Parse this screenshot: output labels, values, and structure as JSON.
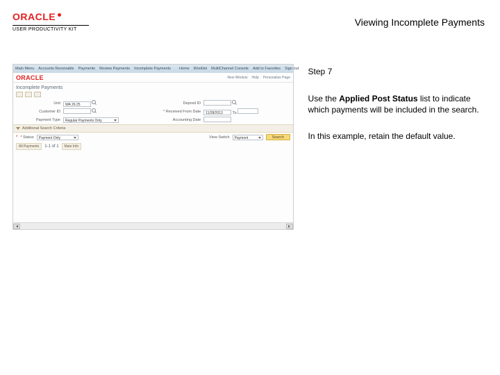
{
  "header": {
    "brand": "ORACLE",
    "upk": "USER PRODUCTIVITY KIT",
    "title": "Viewing Incomplete Payments"
  },
  "instruction": {
    "step": "Step 7",
    "before_bold": "Use the ",
    "bold": "Applied Post Status",
    "after_bold": " list to indicate which payments will be included in the search.",
    "example": "In this example, retain the default value."
  },
  "app": {
    "brand": "ORACLE",
    "breadcrumb": {
      "a": "Main Menu",
      "b": "Accounts Receivable",
      "c": "Payments",
      "d": "Review Payments",
      "e": "Incomplete Payments"
    },
    "topnav": {
      "home": "Home",
      "worklist": "Worklist",
      "mcb": "MultiChannel Console",
      "addfav": "Add to Favorites",
      "signout": "Sign out"
    },
    "rightlinks": {
      "newwin": "New Window",
      "help": "Help",
      "personalize": "Personalize Page"
    },
    "heading": "Incomplete Payments",
    "form": {
      "unit_lbl": "Unit",
      "unit_val": "WA 26.25",
      "deposit_lbl": "Deposit ID",
      "from_lbl": "* Received From Date",
      "from_val": "11/28/2013",
      "to_lbl": "To",
      "cust_lbl": "Customer ID",
      "paytype_lbl": "Payment Type",
      "paytype_val": "Regular Payments Only",
      "accdate_lbl": "Accounting Date"
    },
    "sections": {
      "addl": "Additional Search Criteria"
    },
    "status_lbl": "* Status",
    "status_val": "Payment Only",
    "viewswitch_lbl": "View Switch",
    "viewswitch_val": "Payment",
    "search_btn": "Search",
    "results": {
      "title": "All Payments",
      "cols": "1-1 of 1",
      "main_tab": "Main Info"
    }
  }
}
